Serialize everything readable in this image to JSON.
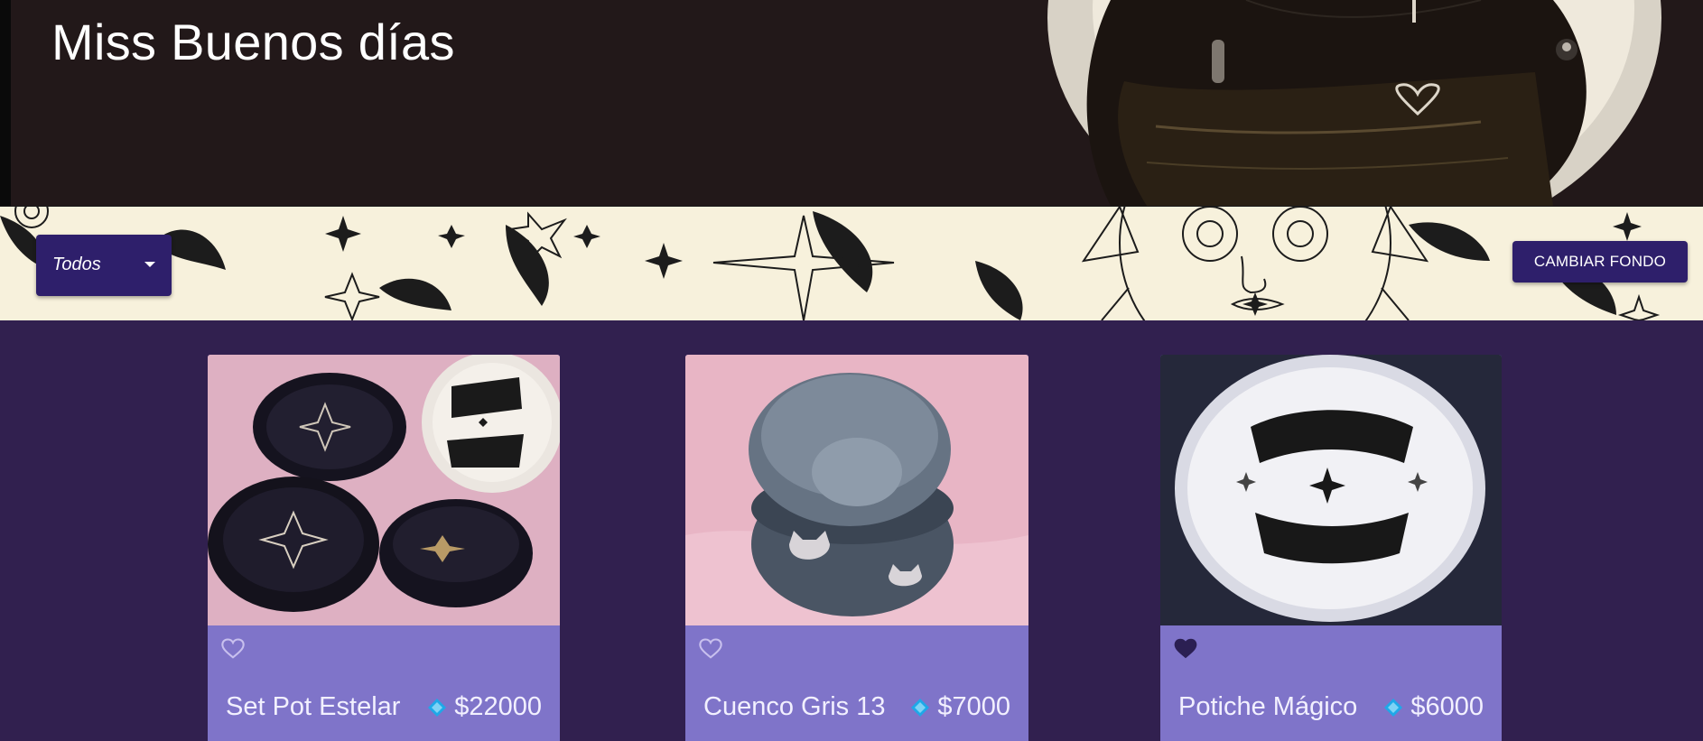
{
  "header": {
    "title": "Miss Buenos días"
  },
  "filter": {
    "selected": "Todos"
  },
  "actions": {
    "change_background": "CAMBIAR FONDO"
  },
  "products": [
    {
      "name": "Set Pot Estelar",
      "price": "$22000",
      "favorite": false,
      "fav_icon": "heart-outline-icon"
    },
    {
      "name": "Cuenco Gris 13",
      "price": "$7000",
      "favorite": false,
      "fav_icon": "heart-outline-icon"
    },
    {
      "name": "Potiche Mágico",
      "price": "$6000",
      "favorite": true,
      "fav_icon": "heart-filled-icon"
    }
  ],
  "colors": {
    "page_bg": "#31204f",
    "header_bg": "#221819",
    "accent_button": "#2e1f6b",
    "card_bg": "#7f74c9",
    "price_diamond": "#1fa8e8"
  }
}
